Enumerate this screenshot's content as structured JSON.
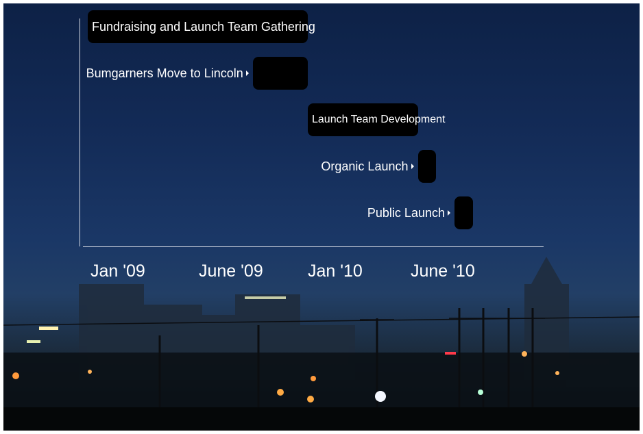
{
  "chart_data": {
    "type": "bar",
    "subtype": "timeline",
    "x_ticks": [
      "Jan '09",
      "June '09",
      "Jan '10",
      "June '10"
    ],
    "xlim": [
      "2008-12",
      "2010-12"
    ],
    "grid": false,
    "legend": "none",
    "bar_color": "#000000",
    "text_color": "#ffffff",
    "tasks": [
      {
        "label": "Fundraising and Launch Team Gathering",
        "start": "2008-12",
        "end": "2009-12",
        "label_position": "inside"
      },
      {
        "label": "Bumgarners Move to Lincoln",
        "start": "2009-09",
        "end": "2009-12",
        "label_position": "outside"
      },
      {
        "label": "Launch Team Development",
        "start": "2009-12",
        "end": "2010-06",
        "label_position": "inside"
      },
      {
        "label": "Organic Launch",
        "start": "2010-06",
        "end": "2010-07",
        "label_position": "outside"
      },
      {
        "label": "Public Launch",
        "start": "2010-08",
        "end": "2010-09",
        "label_position": "outside"
      }
    ]
  }
}
